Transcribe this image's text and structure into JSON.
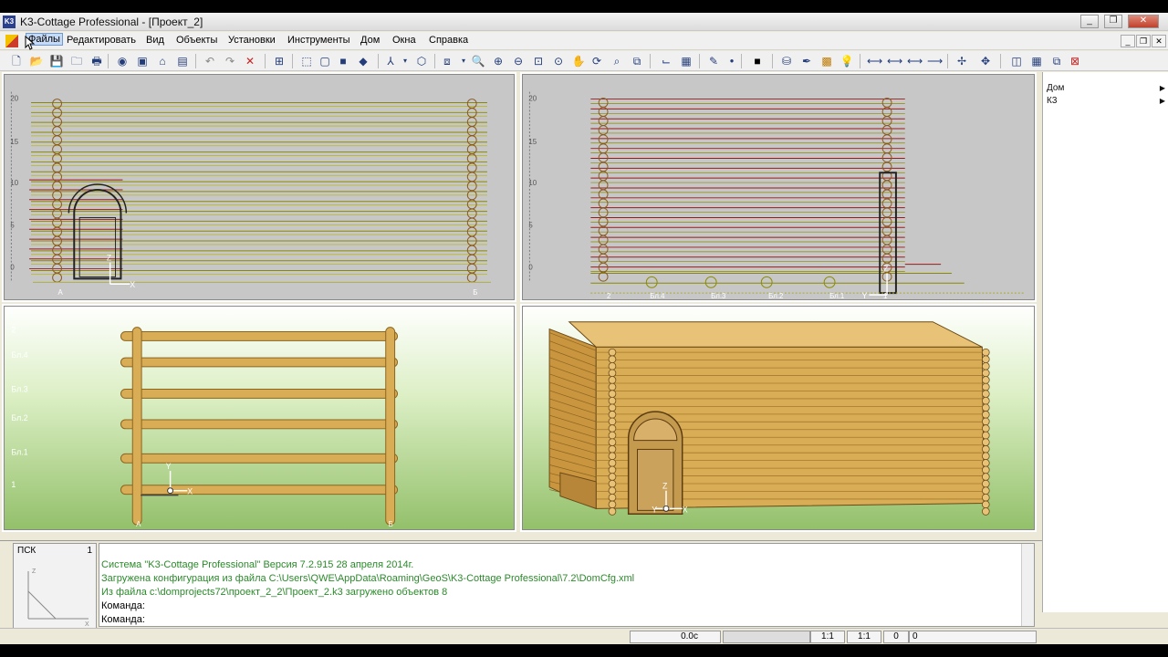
{
  "window": {
    "title": "K3-Cottage Professional - [Проект_2]",
    "icon": "k3-logo-icon",
    "controls": [
      "minimize",
      "maximize",
      "close"
    ]
  },
  "menu": {
    "items": [
      "Файлы",
      "Редактировать",
      "Вид",
      "Объекты",
      "Установки",
      "Инструменты",
      "Дом",
      "Окна",
      "Справка"
    ]
  },
  "viewports": {
    "front": {
      "y_ticks": [
        "20",
        "15",
        "10",
        "5",
        "0"
      ],
      "x_labels": [
        "А",
        "Б"
      ],
      "axis_z": "Z",
      "axis_x": "X"
    },
    "side": {
      "y_ticks": [
        "20",
        "15",
        "10",
        "5",
        "0"
      ],
      "x_labels": [
        "2",
        "Бл.4",
        "Бл.3",
        "Бл.2",
        "Бл.1",
        "1"
      ],
      "axis_z": "Z",
      "axis_y": "Y"
    },
    "plan": {
      "y_labels": [
        "2",
        "Бл.4",
        "Бл.3",
        "Бл.2",
        "Бл.1",
        "1"
      ],
      "x_labels": [
        "А",
        "Б"
      ],
      "axis_y": "Y",
      "axis_x": "X"
    },
    "perspective": {
      "axis_z": "Z",
      "axis_y": "Y",
      "axis_x": "X"
    }
  },
  "right_panel": {
    "items": [
      "Дом",
      "К3"
    ]
  },
  "psk": {
    "label": "ПСК",
    "number": "1",
    "axis_z": "Z",
    "axis_x": "X"
  },
  "log": {
    "lines": [
      "Система \"K3-Cottage Professional\" Версия 7.2.915  28 апреля 2014г.",
      "Загружена конфигурация из файла C:\\Users\\QWE\\AppData\\Roaming\\GeoS\\K3-Cottage Professional\\7.2\\DomCfg.xml",
      "Из файла c:\\domprojects72\\проект_2_2\\Проект_2.k3 загружено объектов 8"
    ],
    "command_label": "Команда:"
  },
  "status": {
    "time": "0.0c",
    "scale1": "1:1",
    "scale2": "1:1",
    "val1": "0",
    "val2": "0"
  },
  "colors": {
    "log_green": "#2b8a2b",
    "log_wood": "#d9ad55",
    "log_outline": "#8a6420",
    "grid_olive": "#8a8a00",
    "red_lines": "#9a1a1a"
  }
}
